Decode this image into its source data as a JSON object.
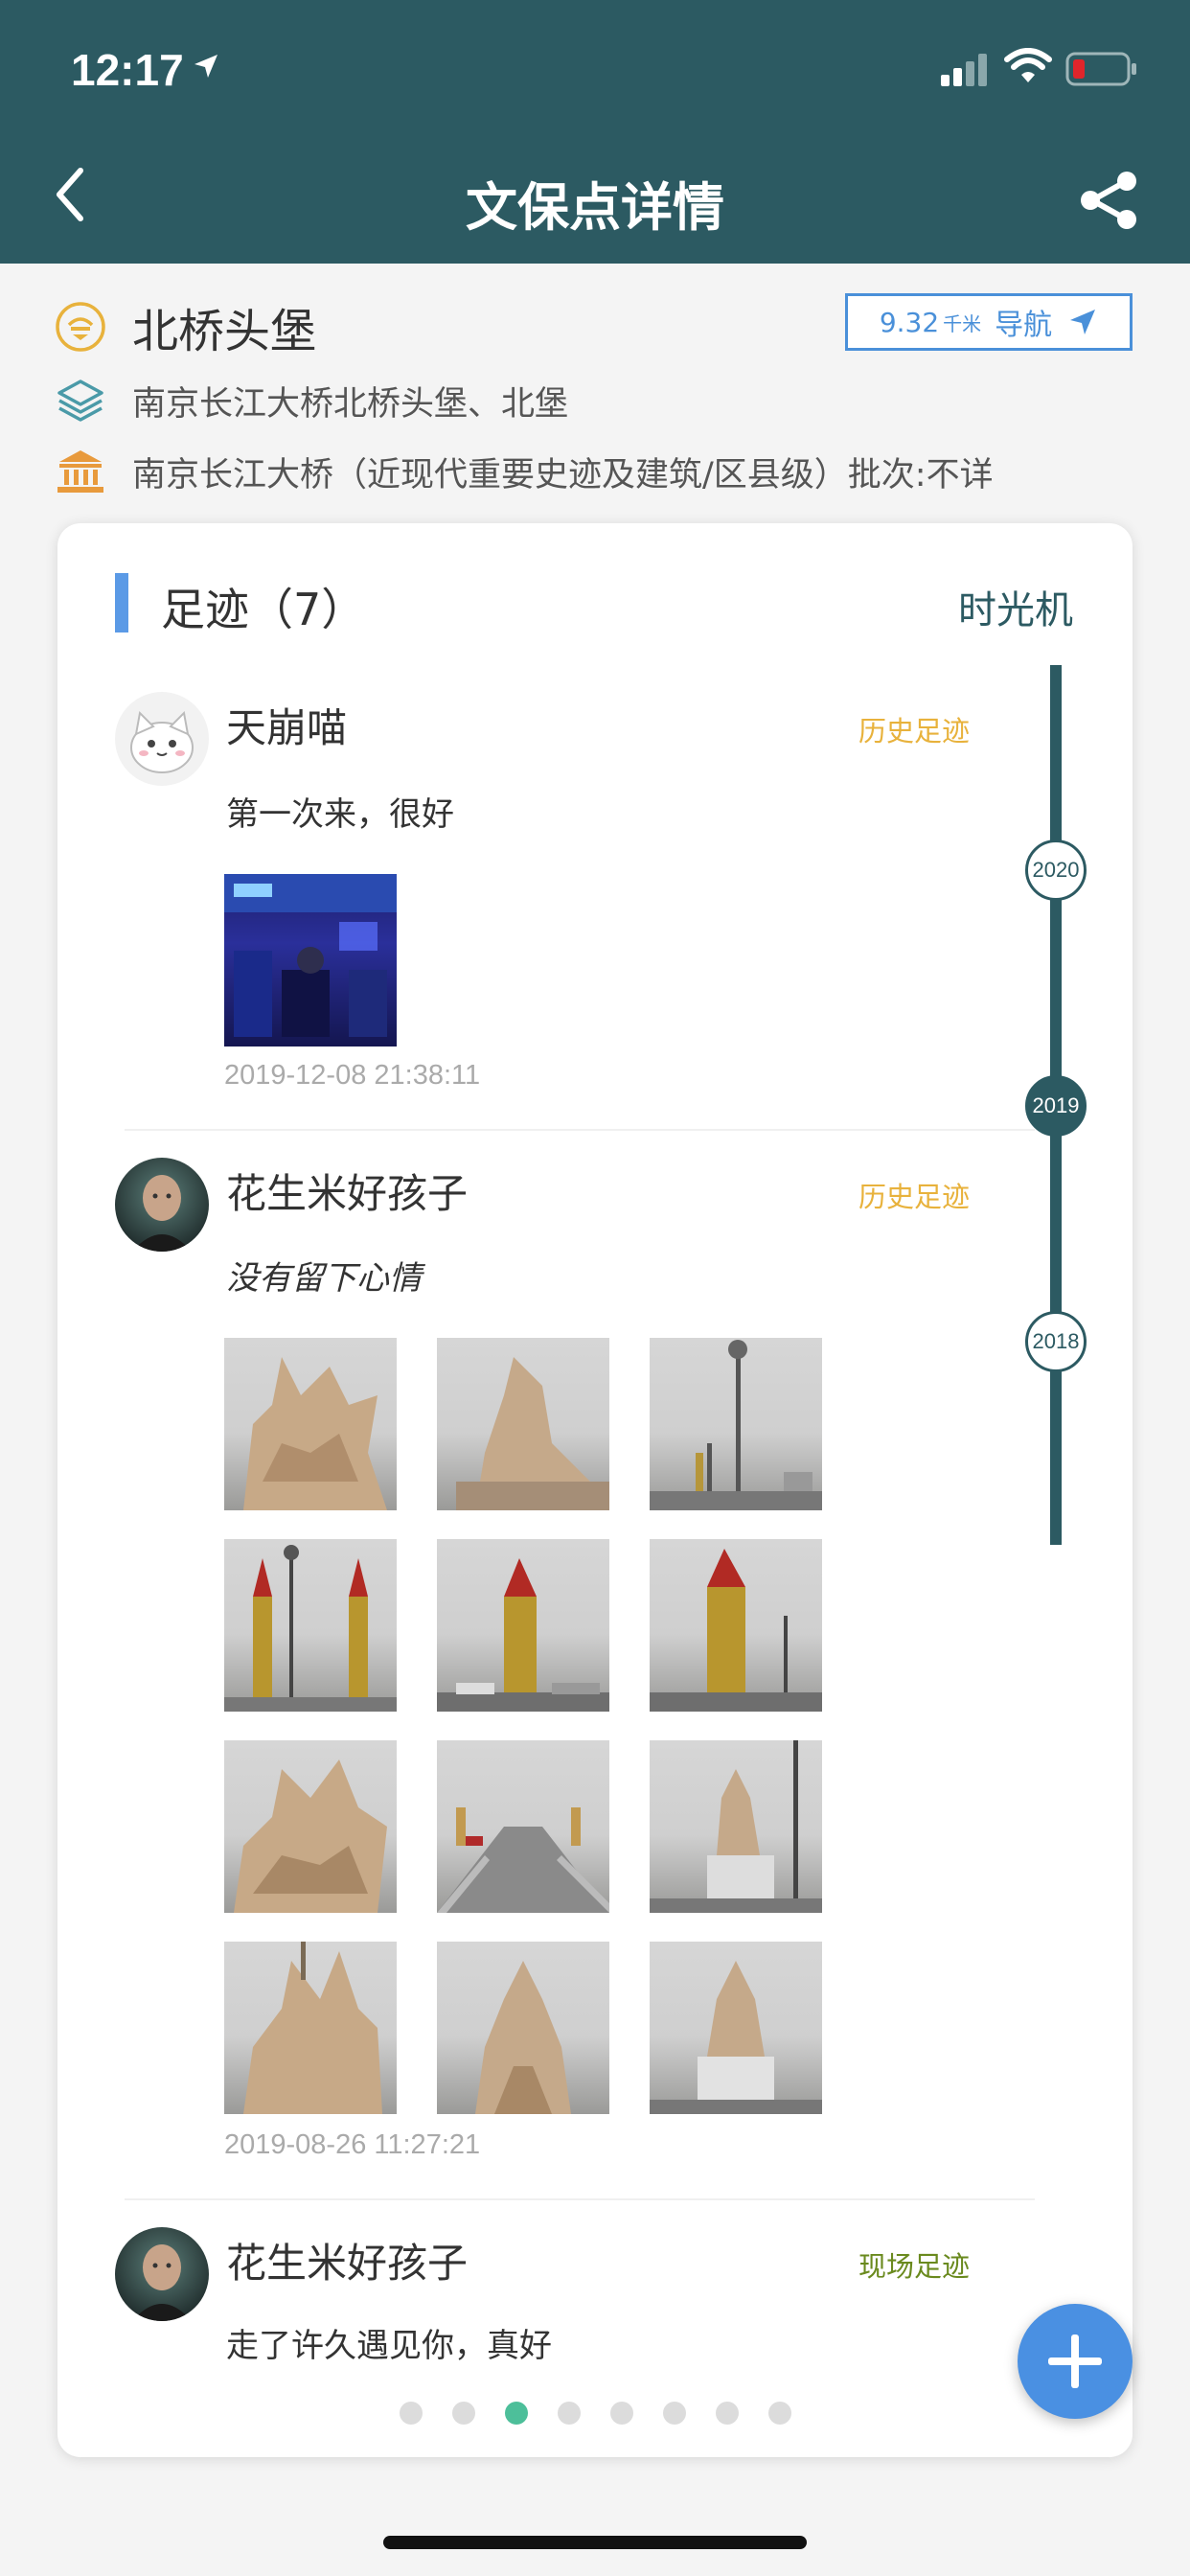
{
  "status": {
    "time": "12:17"
  },
  "header": {
    "title": "文保点详情"
  },
  "site": {
    "name": "北桥头堡",
    "alias": "南京长江大桥北桥头堡、北堡",
    "heritage": "南京长江大桥（近现代重要史迹及建筑/区县级）批次:不详",
    "distance": "9.32",
    "distance_unit": "千米",
    "nav_label": "导航"
  },
  "footprints": {
    "title": "足迹（7）",
    "time_machine": "时光机",
    "entries": [
      {
        "name": "天崩喵",
        "tag": "历史足迹",
        "text": "第一次来，很好",
        "date": "2019-12-08 21:38:11"
      },
      {
        "name": "花生米好孩子",
        "tag": "历史足迹",
        "text": "没有留下心情",
        "date": "2019-08-26 11:27:21"
      },
      {
        "name": "花生米好孩子",
        "tag": "现场足迹",
        "text": "走了许久遇见你，真好"
      }
    ]
  },
  "timeline": {
    "years": [
      "2020",
      "2019",
      "2018"
    ],
    "active": "2019"
  },
  "pagination": {
    "count": 8,
    "active_index": 3
  },
  "colors": {
    "header": "#2c5a62",
    "history_tag": "#e8b23c",
    "onsite_tag": "#6a8a1e",
    "accent": "#4a90e2",
    "nav_border": "#4a90d9"
  }
}
